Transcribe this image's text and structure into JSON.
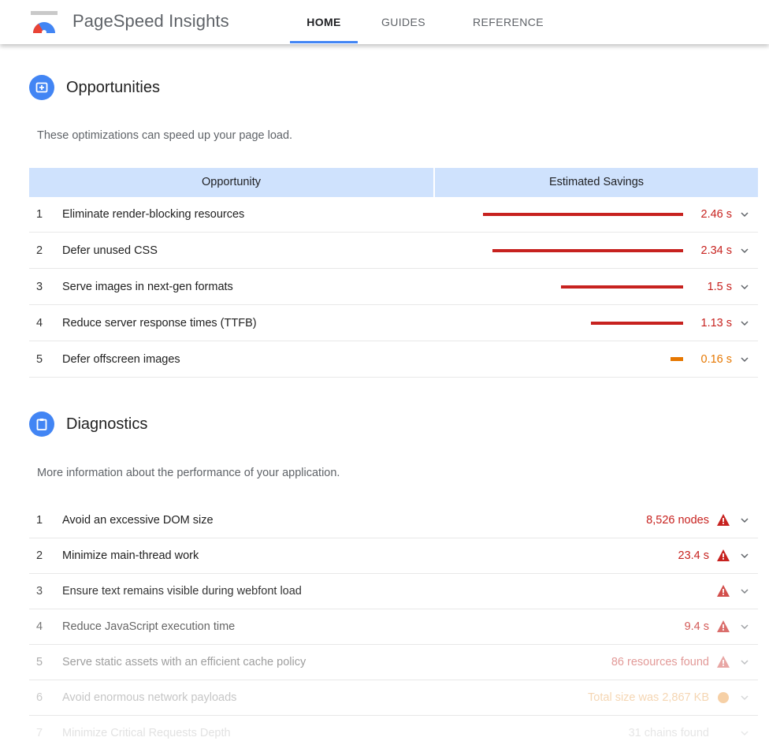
{
  "nav": {
    "brand": "PageSpeed Insights",
    "tabs": [
      {
        "label": "HOME",
        "active": true
      },
      {
        "label": "GUIDES",
        "active": false
      },
      {
        "label": "REFERENCE",
        "active": false
      }
    ]
  },
  "opportunities": {
    "title": "Opportunities",
    "description": "These optimizations can speed up your page load.",
    "col_opportunity": "Opportunity",
    "col_savings": "Estimated Savings",
    "rows": [
      {
        "num": "1",
        "label": "Eliminate render-blocking resources",
        "value": "2.46 s",
        "severity": "fail"
      },
      {
        "num": "2",
        "label": "Defer unused CSS",
        "value": "2.34 s",
        "severity": "fail"
      },
      {
        "num": "3",
        "label": "Serve images in next-gen formats",
        "value": "1.5 s",
        "severity": "fail"
      },
      {
        "num": "4",
        "label": "Reduce server response times (TTFB)",
        "value": "1.13 s",
        "severity": "fail"
      },
      {
        "num": "5",
        "label": "Defer offscreen images",
        "value": "0.16 s",
        "severity": "average"
      }
    ]
  },
  "diagnostics": {
    "title": "Diagnostics",
    "description": "More information about the performance of your application.",
    "rows": [
      {
        "num": "1",
        "label": "Avoid an excessive DOM size",
        "value": "8,526 nodes",
        "severity": "fail"
      },
      {
        "num": "2",
        "label": "Minimize main-thread work",
        "value": "23.4 s",
        "severity": "fail"
      },
      {
        "num": "3",
        "label": "Ensure text remains visible during webfont load",
        "value": "",
        "severity": "fail"
      },
      {
        "num": "4",
        "label": "Reduce JavaScript execution time",
        "value": "9.4 s",
        "severity": "fail"
      },
      {
        "num": "5",
        "label": "Serve static assets with an efficient cache policy",
        "value": "86 resources found",
        "severity": "fail"
      },
      {
        "num": "6",
        "label": "Avoid enormous network payloads",
        "value": "Total size was 2,867 KB",
        "severity": "average"
      },
      {
        "num": "7",
        "label": "Minimize Critical Requests Depth",
        "value": "31 chains found",
        "severity": "info"
      }
    ]
  },
  "colors": {
    "accent": "#4285f4",
    "fail": "#c7221f",
    "average": "#e67700",
    "table_header": "#cfe2fd"
  }
}
